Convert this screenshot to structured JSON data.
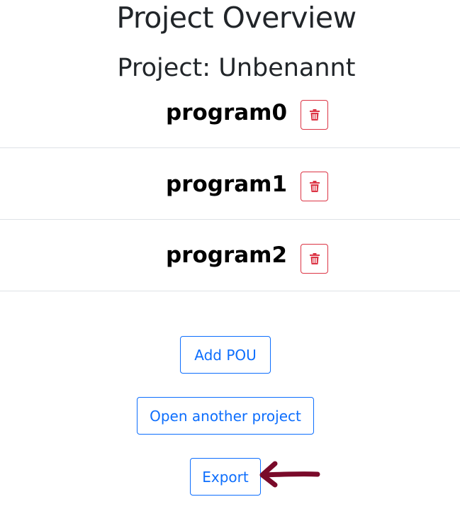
{
  "header": {
    "title": "Project Overview",
    "project_label": "Project: Unbenannt"
  },
  "pous": [
    {
      "name": "program0",
      "delete_icon": "trash-icon"
    },
    {
      "name": "program1",
      "delete_icon": "trash-icon"
    },
    {
      "name": "program2",
      "delete_icon": "trash-icon"
    }
  ],
  "actions": {
    "add_pou": "Add POU",
    "open_project": "Open another project",
    "export": "Export"
  },
  "colors": {
    "primary": "#0d6efd",
    "danger": "#dc3545",
    "divider": "#dee2e6",
    "annotation_arrow": "#7a0a2a"
  }
}
